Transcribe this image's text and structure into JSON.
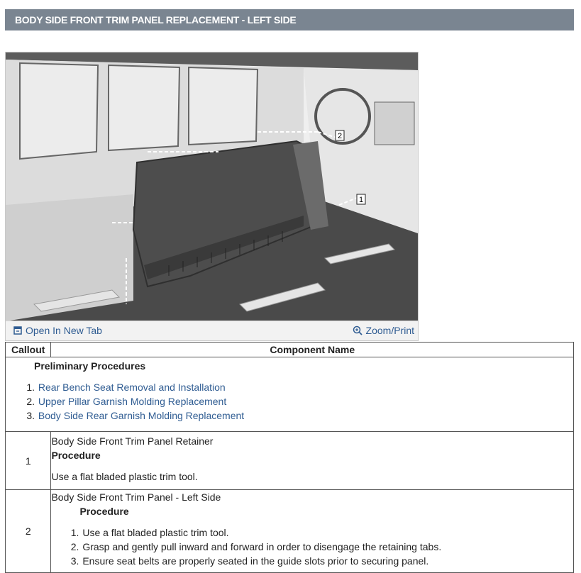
{
  "header": {
    "title": "BODY SIDE FRONT TRIM PANEL REPLACEMENT - LEFT SIDE"
  },
  "figure": {
    "callout_labels": [
      "1",
      "2"
    ],
    "open_tab_label": "Open In New Tab",
    "zoom_label": "Zoom/Print",
    "icons": {
      "open": "open-new-tab-icon",
      "zoom": "zoom-icon"
    }
  },
  "table": {
    "headers": {
      "callout": "Callout",
      "component": "Component Name"
    },
    "preliminary": {
      "heading": "Preliminary Procedures",
      "items": [
        {
          "num": "1.",
          "text": "Rear Bench Seat Removal and Installation"
        },
        {
          "num": "2.",
          "text": "Upper Pillar Garnish Molding Replacement"
        },
        {
          "num": "3.",
          "text": "Body Side Rear Garnish Molding Replacement"
        }
      ]
    },
    "rows": [
      {
        "callout": "1",
        "name": "Body Side Front Trim Panel Retainer",
        "procedure_label": "Procedure",
        "text": "Use a flat bladed plastic trim tool."
      },
      {
        "callout": "2",
        "name": "Body Side Front Trim Panel - Left Side",
        "procedure_label": "Procedure",
        "steps": [
          {
            "num": "1.",
            "text": "Use a flat bladed plastic trim tool."
          },
          {
            "num": "2.",
            "text": "Grasp and gently pull inward and forward in order to disengage the retaining tabs."
          },
          {
            "num": "3.",
            "text": "Ensure seat belts are properly seated in the guide slots prior to securing panel."
          }
        ]
      }
    ]
  },
  "colors": {
    "title_bg": "#7a8591",
    "link": "#2f5c92"
  }
}
